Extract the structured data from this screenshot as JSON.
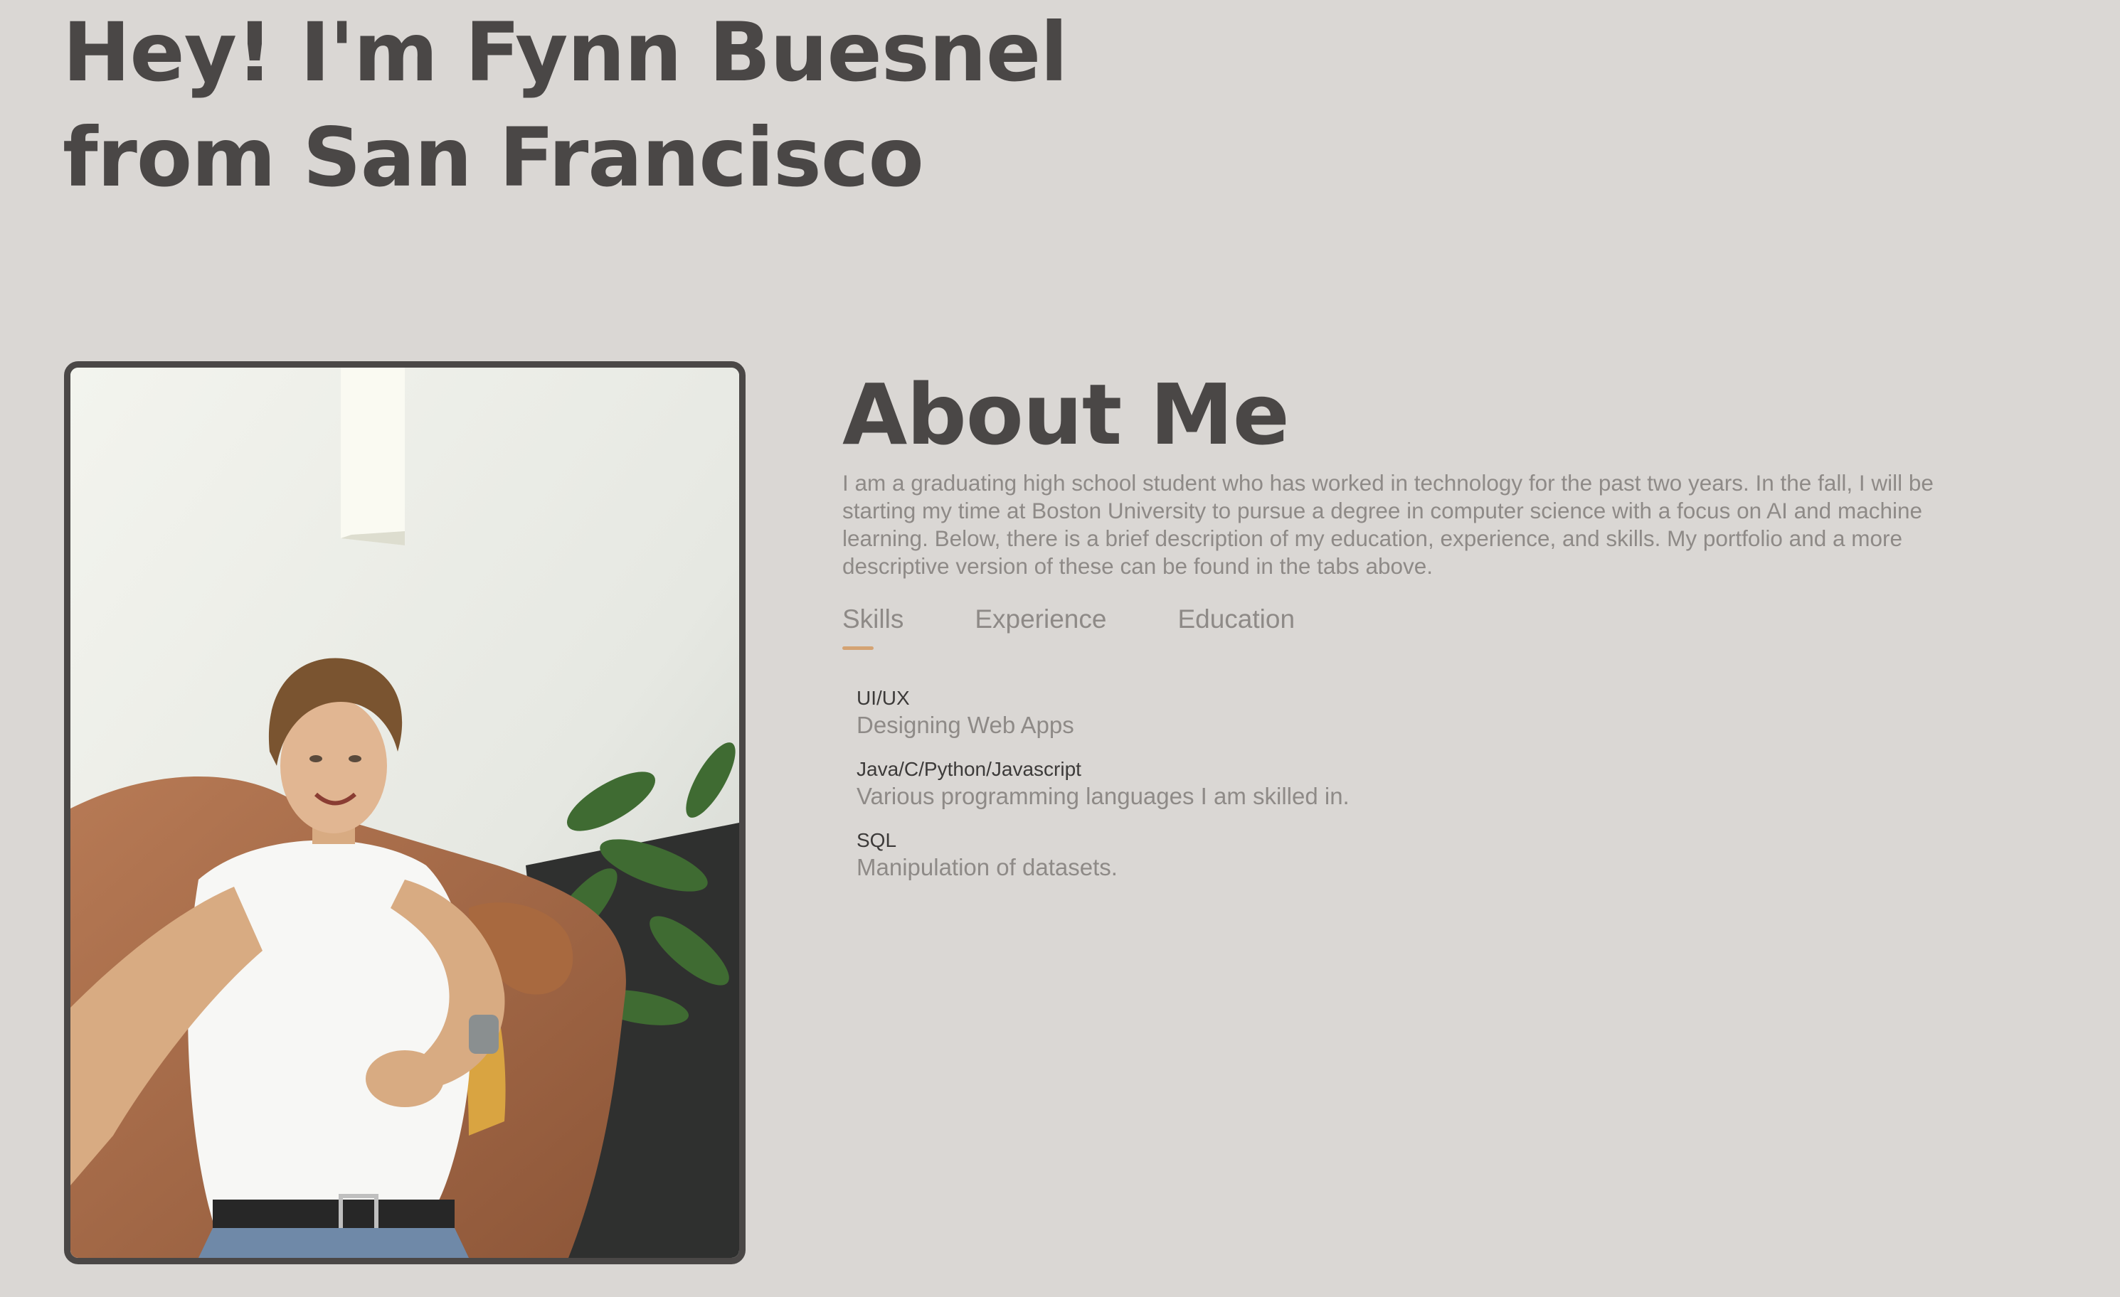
{
  "hero": {
    "line1": "Hey! I'm Fynn Buesnel",
    "line2": "from San Francisco"
  },
  "profile_photo": {
    "alt": "Fynn Buesnel"
  },
  "about": {
    "title": "About Me",
    "text": "I am a graduating high school student who has worked in technology for the past two years. In the fall, I will be starting my time at Boston University to pursue a degree in computer science with a focus on AI and machine learning. Below, there is a brief description of my education, experience, and skills. My portfolio and a more descriptive version of these can be found in the tabs above."
  },
  "tabs": [
    {
      "label": "Skills",
      "active": true
    },
    {
      "label": "Experience",
      "active": false
    },
    {
      "label": "Education",
      "active": false
    }
  ],
  "skills": [
    {
      "name": "UI/UX",
      "desc": "Designing Web Apps"
    },
    {
      "name": "Java/C/Python/Javascript",
      "desc": "Various programming languages I am skilled in."
    },
    {
      "name": "SQL",
      "desc": "Manipulation of datasets."
    }
  ],
  "colors": {
    "background": "#dad7d4",
    "heading": "#4a4746",
    "body_text": "#8e8a87",
    "accent": "#d4a373"
  }
}
